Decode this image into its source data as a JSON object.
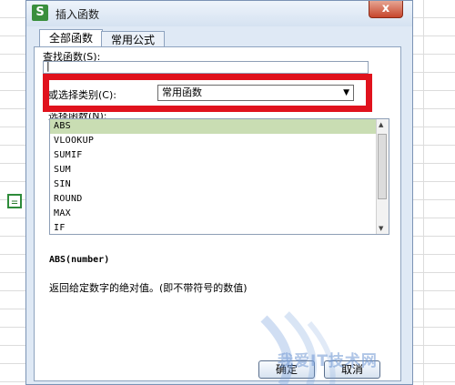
{
  "dialog": {
    "app_icon_letter": "S",
    "title": "插入函数",
    "close_label": "x"
  },
  "tabs": [
    {
      "label": "全部函数",
      "active": true
    },
    {
      "label": "常用公式",
      "active": false
    }
  ],
  "search": {
    "label": "查找函数(S):",
    "value": "|"
  },
  "category": {
    "label": "或选择类别(C):",
    "selected": "常用函数"
  },
  "function_list": {
    "label": "选择函数(N):",
    "items": [
      "ABS",
      "VLOOKUP",
      "SUMIF",
      "SUM",
      "SIN",
      "ROUND",
      "MAX",
      "IF"
    ],
    "selected_index": 0
  },
  "details": {
    "syntax": "ABS(number)",
    "description": "返回给定数字的绝对值。(即不带符号的数值)"
  },
  "buttons": {
    "ok": "确定",
    "cancel": "取消"
  },
  "sheet": {
    "active_cell_text": "="
  },
  "watermark": {
    "text": "我爱IT技术网"
  },
  "colors": {
    "highlight_box": "#e0121d",
    "selected_row": "#c9ddb3",
    "dialog_bg": "#dfe9f5"
  }
}
